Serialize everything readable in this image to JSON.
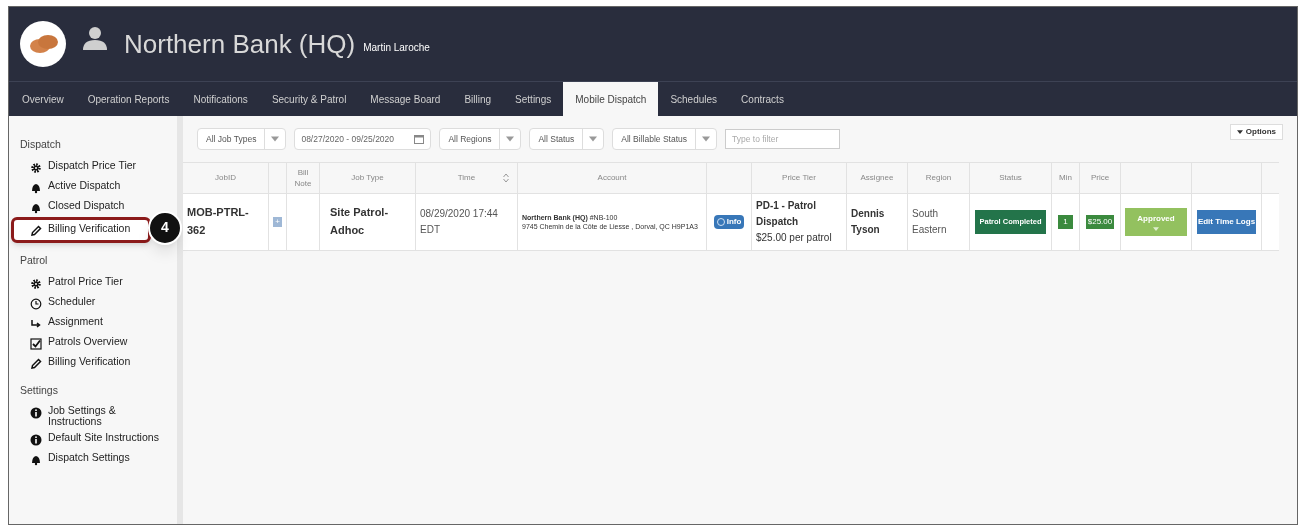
{
  "header": {
    "title": "Northern Bank (HQ)",
    "user": "Martin Laroche"
  },
  "tabs": [
    {
      "label": "Overview",
      "selected": false
    },
    {
      "label": "Operation Reports",
      "selected": false
    },
    {
      "label": "Notifications",
      "selected": false
    },
    {
      "label": "Security & Patrol",
      "selected": false
    },
    {
      "label": "Message Board",
      "selected": false
    },
    {
      "label": "Billing",
      "selected": false
    },
    {
      "label": "Settings",
      "selected": false
    },
    {
      "label": "Mobile Dispatch",
      "selected": true
    },
    {
      "label": "Schedules",
      "selected": false
    },
    {
      "label": "Contracts",
      "selected": false
    }
  ],
  "sidebar": [
    {
      "title": "Dispatch",
      "items": [
        {
          "label": "Dispatch Price Tier",
          "kind": "gear"
        },
        {
          "label": "Active Dispatch",
          "kind": "bell"
        },
        {
          "label": "Closed Dispatch",
          "kind": "bell"
        },
        {
          "label": "Billing Verification",
          "kind": "pencil",
          "callout": "4"
        }
      ]
    },
    {
      "title": "Patrol",
      "items": [
        {
          "label": "Patrol Price Tier",
          "kind": "gear"
        },
        {
          "label": "Scheduler",
          "kind": "clock"
        },
        {
          "label": "Assignment",
          "kind": "arrow"
        },
        {
          "label": "Patrols Overview",
          "kind": "check"
        },
        {
          "label": "Billing Verification",
          "kind": "pencil"
        }
      ]
    },
    {
      "title": "Settings",
      "items": [
        {
          "label": "Job Settings & Instructions",
          "kind": "info"
        },
        {
          "label": "Default Site Instructions",
          "kind": "info"
        },
        {
          "label": "Dispatch Settings",
          "kind": "bell"
        }
      ]
    }
  ],
  "filters": [
    {
      "kind": "select",
      "label": "All Job Types"
    },
    {
      "kind": "date",
      "label": "08/27/2020 - 09/25/2020"
    },
    {
      "kind": "select",
      "label": "All Regions"
    },
    {
      "kind": "select",
      "label": "All Status"
    },
    {
      "kind": "select",
      "label": "All Billable Status"
    },
    {
      "kind": "text",
      "placeholder": "Type to filter"
    }
  ],
  "options_button": "Options",
  "table": {
    "columns": [
      "JobID",
      "",
      "Bill Note",
      "Job Type",
      "Time",
      "Account",
      "",
      "Price Tier",
      "Assignee",
      "Region",
      "Status",
      "Min",
      "Price",
      "",
      ""
    ],
    "rows": [
      {
        "job_id": "MOB-PTRL-362",
        "add": "+",
        "job_type": "Site Patrol-Adhoc",
        "time": "08/29/2020 17:44 EDT",
        "account_name": "Northern Bank (HQ)",
        "account_code": "#NB-100",
        "account_address": "9745 Chemin de la Côte de Liesse , Dorval, QC H9P1A3",
        "info": "Info",
        "price_tier": "PD-1 - Patrol Dispatch",
        "price_rate": "$25.00 per patrol",
        "assignee": "Dennis Tyson",
        "region": "South Eastern",
        "status": "Patrol Completed",
        "min": "1",
        "price": "$25.00",
        "approval": "Approved",
        "edit": "Edit Time Logs"
      }
    ]
  }
}
